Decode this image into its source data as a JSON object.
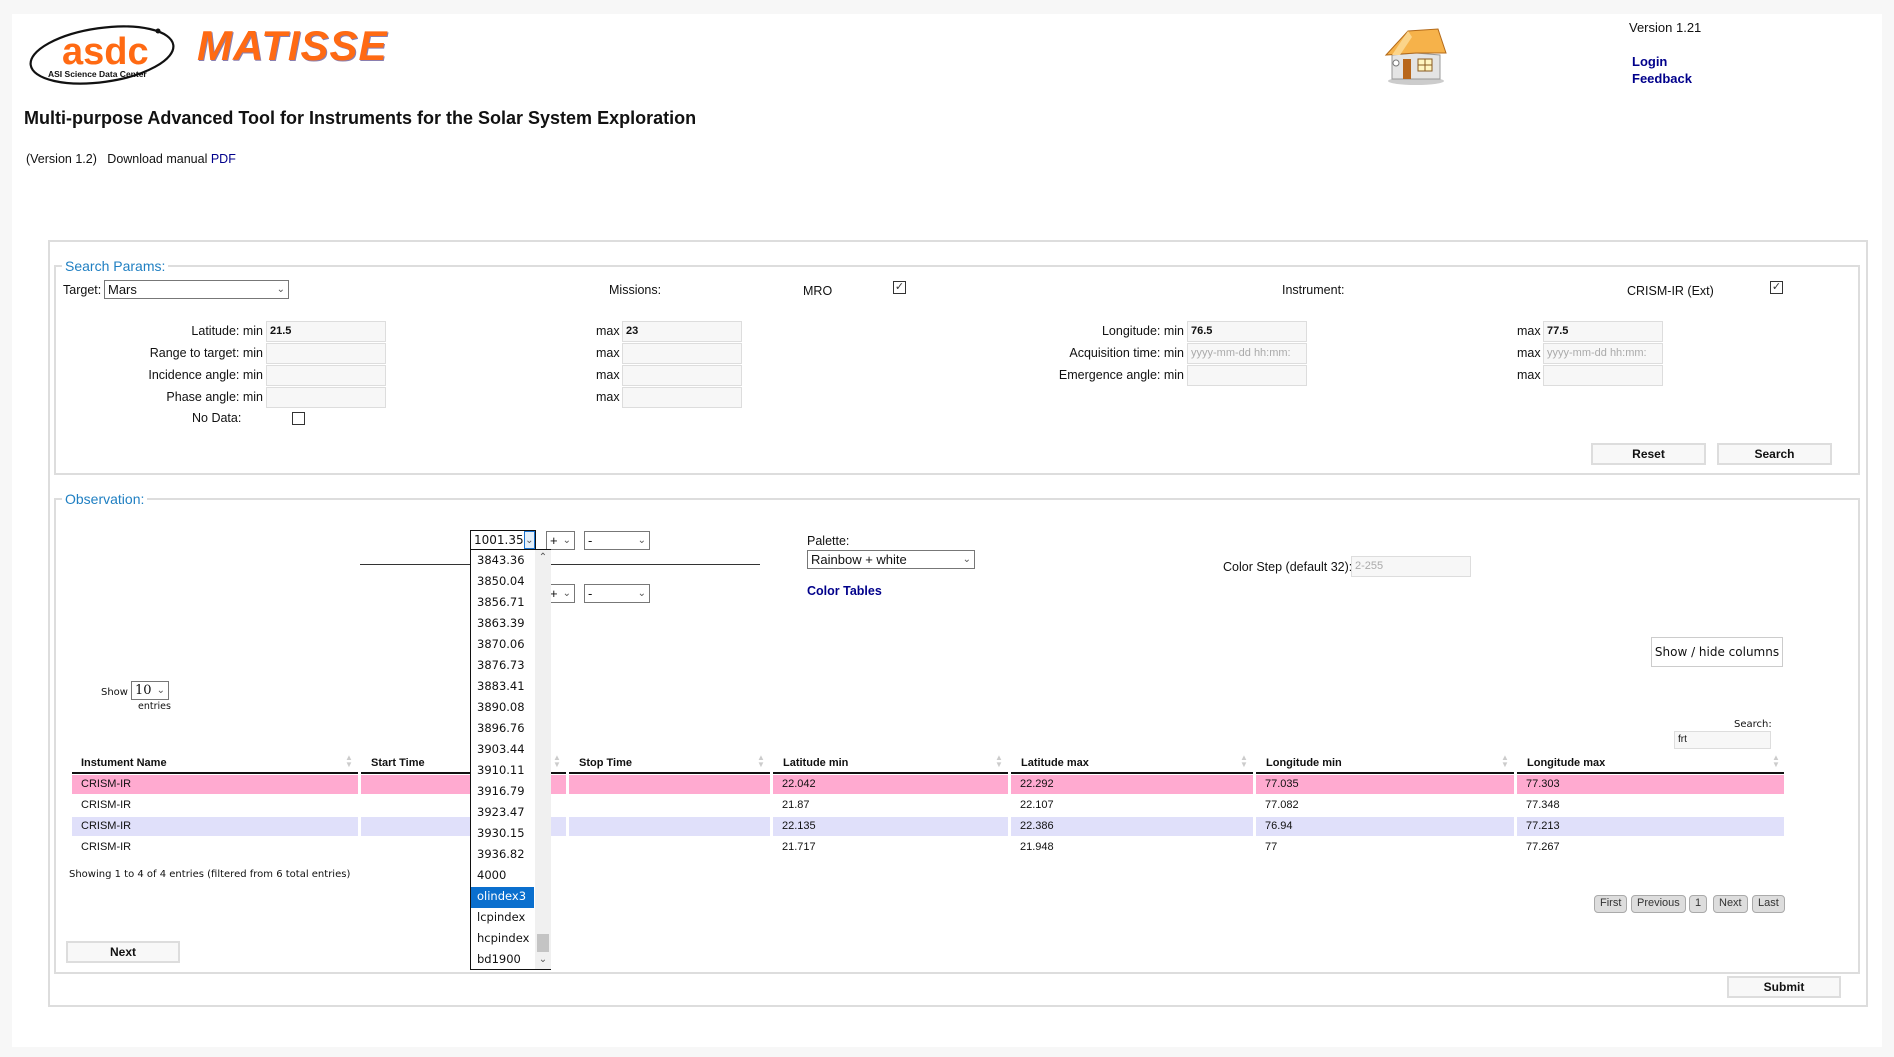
{
  "header": {
    "logo_text": "asdc",
    "logo_subtext": "ASI Science Data Center",
    "app_name": "MATISSE",
    "version_top": "Version 1.21",
    "login_label": "Login",
    "feedback_label": "Feedback",
    "subtitle": "Multi-purpose Advanced Tool for Instruments for the Solar System Exploration",
    "version_note": "(Version 1.2)",
    "download_label": "Download manual",
    "pdf_label": "PDF"
  },
  "search_params": {
    "legend": "Search Params:",
    "target_label": "Target:",
    "target_value": "Mars",
    "missions_label": "Missions:",
    "mission_name": "MRO",
    "mission_checked": true,
    "instrument_label": "Instrument:",
    "instrument_name": "CRISM-IR (Ext)",
    "instrument_checked": true,
    "min_label": "min",
    "max_label": "max",
    "latitude_label": "Latitude: min",
    "latitude_min": "21.5",
    "latitude_max": "23",
    "range_label": "Range to target: min",
    "incidence_label": "Incidence angle: min",
    "phase_label": "Phase angle: min",
    "nodata_label": "No Data:",
    "longitude_label": "Longitude: min",
    "longitude_min": "76.5",
    "longitude_max": "77.5",
    "acq_label": "Acquisition time: min",
    "acq_placeholder": "yyyy-mm-dd hh:mm:",
    "emergence_label": "Emergence angle: min",
    "reset_label": "Reset",
    "search_label": "Search"
  },
  "observation": {
    "legend": "Observation:",
    "band_select_value": "1001.35",
    "op1_value": "+",
    "op2_value": "+",
    "band2_select_value": "-",
    "band3_select_value": "-",
    "dropdown_options": [
      "3843.36",
      "3850.04",
      "3856.71",
      "3863.39",
      "3870.06",
      "3876.73",
      "3883.41",
      "3890.08",
      "3896.76",
      "3903.44",
      "3910.11",
      "3916.79",
      "3923.47",
      "3930.15",
      "3936.82",
      "4000",
      "olindex3",
      "lcpindex",
      "hcpindex",
      "bd1900"
    ],
    "dropdown_selected": "olindex3",
    "palette_label": "Palette:",
    "palette_value": "Rainbow + white",
    "color_tables_label": "Color Tables",
    "color_step_label": "Color Step (default 32):",
    "color_step_placeholder": "2-255",
    "show_hide_label": "Show / hide columns",
    "show_label": "Show",
    "show_value": "10",
    "entries_label": "entries",
    "table_search_label": "Search:",
    "table_search_value": "frt",
    "columns": [
      "Instument Name",
      "Start Time",
      "Stop Time",
      "Latitude min",
      "Latitude max",
      "Longitude min",
      "Longitude max"
    ],
    "rows": [
      [
        "CRISM-IR",
        "",
        "",
        "22.042",
        "22.292",
        "77.035",
        "77.303"
      ],
      [
        "CRISM-IR",
        "",
        "",
        "21.87",
        "22.107",
        "77.082",
        "77.348"
      ],
      [
        "CRISM-IR",
        "",
        "",
        "22.135",
        "22.386",
        "76.94",
        "77.213"
      ],
      [
        "CRISM-IR",
        "",
        "",
        "21.717",
        "21.948",
        "77",
        "77.267"
      ]
    ],
    "row_colors": [
      "#ffaad0",
      "#ffffff",
      "#e0e0fa",
      "#ffffff"
    ],
    "info": "Showing 1 to 4 of 4 entries (filtered from 6 total entries)",
    "pagination": [
      "First",
      "Previous",
      "1",
      "Next",
      "Last"
    ],
    "next_label": "Next",
    "submit_label": "Submit"
  }
}
